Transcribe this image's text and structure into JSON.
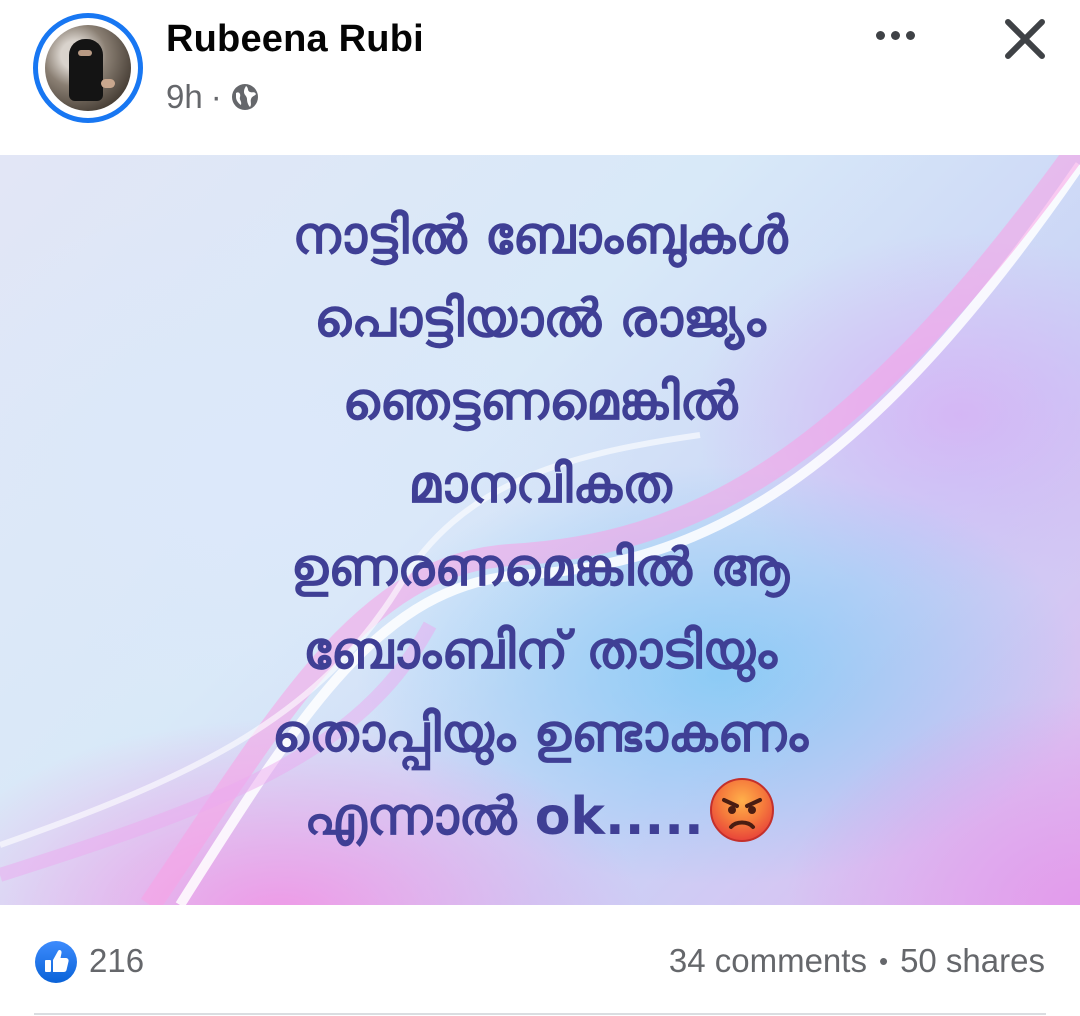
{
  "post": {
    "author_name": "Rubeena Rubi",
    "time": "9h",
    "meta_separator": "·",
    "privacy_icon": "globe-icon",
    "image_text_lines": [
      "നാട്ടിൽ ബോംബുകൾ",
      "പൊട്ടിയാൽ രാജ്യം",
      "ഞെട്ടണമെങ്കിൽ",
      "മാനവികത",
      "ഉണരണമെങ്കിൽ ആ",
      "ബോംബിന് താടിയും",
      "തൊപ്പിയും ഉണ്ടാകണം",
      "എന്നാൽ ok....."
    ],
    "text_color": "#3f3f95",
    "emoji": "angry-face-icon"
  },
  "header": {
    "more_icon": "more-options-icon",
    "close_icon": "close-icon"
  },
  "footer": {
    "reaction_icon": "like-icon",
    "like_count": "216",
    "comments": "34 comments",
    "separator": "•",
    "shares": "50 shares"
  },
  "colors": {
    "accent": "#1877f2",
    "secondary_text": "#65676b"
  }
}
